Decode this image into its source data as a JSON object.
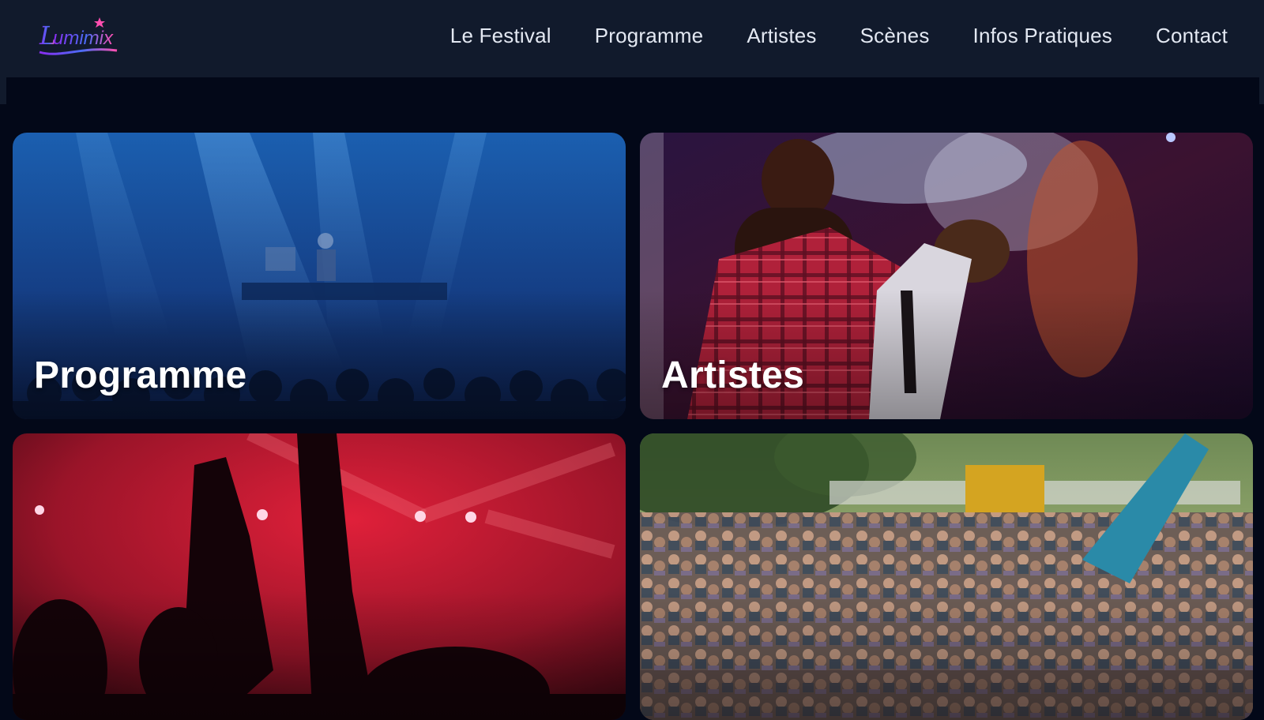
{
  "brand": {
    "logo_text": "Lumimix"
  },
  "nav": {
    "items": [
      {
        "label": "Le Festival"
      },
      {
        "label": "Programme"
      },
      {
        "label": "Artistes"
      },
      {
        "label": "Scènes"
      },
      {
        "label": "Infos Pratiques"
      },
      {
        "label": "Contact"
      }
    ]
  },
  "cards": [
    {
      "title": "Programme"
    },
    {
      "title": "Artistes"
    },
    {
      "title": ""
    },
    {
      "title": ""
    }
  ],
  "colors": {
    "page_background": "#030818",
    "header_background": "#111a2c",
    "nav_text": "#e3e8f2",
    "logo_gradient_start": "#7b2cf5",
    "logo_gradient_end": "#ff4fb0"
  }
}
